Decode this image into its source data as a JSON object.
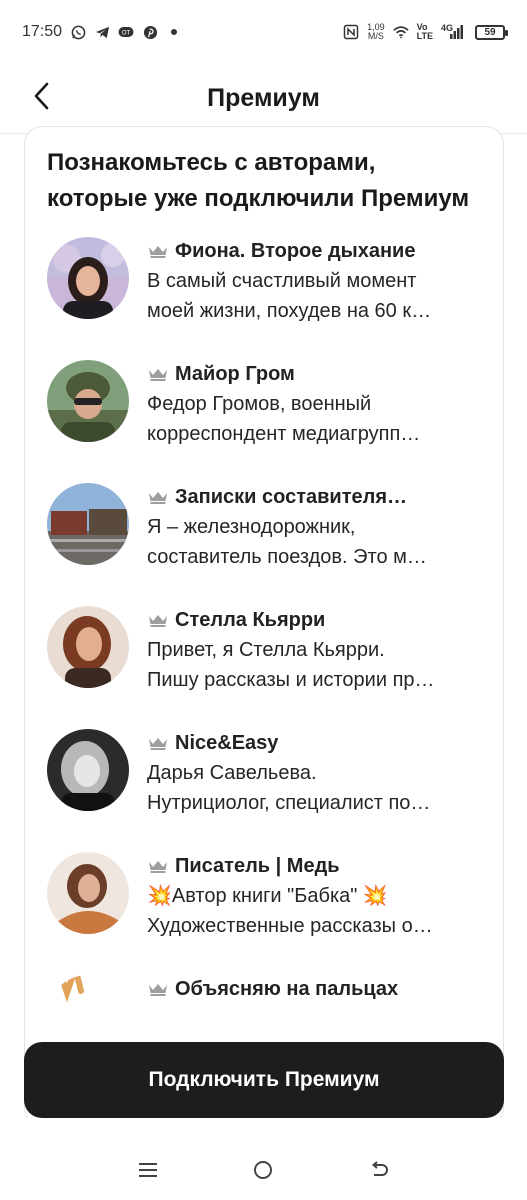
{
  "status_bar": {
    "time": "17:50",
    "speed_value": "1,09",
    "speed_unit": "M/S",
    "network_top": "Vo",
    "network_bottom": "LTE",
    "signal_label": "4G",
    "battery": "59"
  },
  "header": {
    "title": "Премиум"
  },
  "card": {
    "title": "Познакомьтесь с авторами, которые уже подключили Премиум",
    "authors": [
      {
        "name": "Фиона. Второе дыхание",
        "line1": "В самый счастливый момент",
        "line2": "моей жизни, похудев на 60 к…"
      },
      {
        "name": "Майор Гром",
        "line1": "Федор Громов, военный",
        "line2": "корреспондент медиагрупп…"
      },
      {
        "name": "Записки составителя…",
        "line1": "Я – железнодорожник,",
        "line2": "составитель поездов. Это м…"
      },
      {
        "name": "Стелла Кьярри",
        "line1": "Привет, я Стелла Кьярри.",
        "line2": "Пишу рассказы и истории пр…"
      },
      {
        "name": "Nice&Easy",
        "line1": "Дарья Савельева.",
        "line2": "Нутрициолог, специалист по…"
      },
      {
        "name": "Писатель | Медь",
        "line1": "💥Автор книги \"Бабка\" 💥",
        "line2": "Художественные рассказы о…"
      },
      {
        "name": "Объясняю на пальцах",
        "line1": "",
        "line2": ""
      }
    ]
  },
  "cta": {
    "label": "Подключить Премиум"
  },
  "colors": {
    "cta_background": "#1d1d1f",
    "crown": "#9e9e9e",
    "text": "#1f1f1f"
  }
}
